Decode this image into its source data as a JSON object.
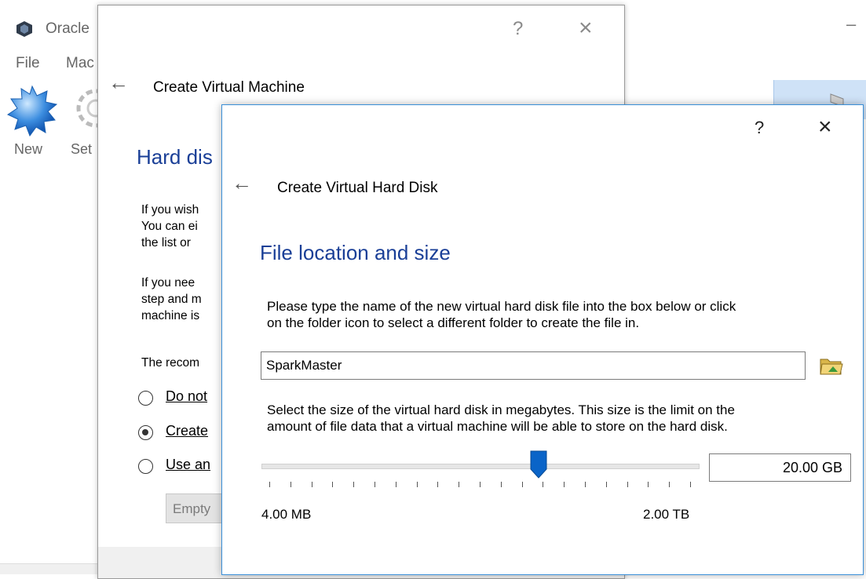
{
  "main_window": {
    "title": "Oracle",
    "menu": [
      "File",
      "Mac"
    ],
    "toolbar": {
      "new_label": "New",
      "settings_label": "Set"
    },
    "minimize": "–"
  },
  "vm_dialog": {
    "help": "?",
    "close": "×",
    "back": "←",
    "title": "Create Virtual Machine",
    "heading": "Hard dis",
    "para1": [
      "If you wish",
      "You can ei",
      "the list or"
    ],
    "para2": [
      "If you nee",
      "step and m",
      "machine is"
    ],
    "para3": "The recom",
    "options": [
      {
        "label": "Do not",
        "checked": false
      },
      {
        "label": "Create",
        "checked": true
      },
      {
        "label": "Use an",
        "checked": false
      }
    ],
    "disk_select": "Empty"
  },
  "hd_dialog": {
    "help": "?",
    "close": "×",
    "back": "←",
    "title": "Create Virtual Hard Disk",
    "heading": "File location and size",
    "location_text_1": "Please type the name of the new virtual hard disk file into the box below or click",
    "location_text_2": "on the folder icon to select a different folder to create the file in.",
    "filename": "SparkMaster",
    "size_text_1": "Select the size of the virtual hard disk in megabytes. This size is the limit on the",
    "size_text_2": "amount of file data that a virtual machine will be able to store on the hard disk.",
    "slider": {
      "min_label": "4.00 MB",
      "max_label": "2.00 TB",
      "position_fraction": 0.635
    },
    "size_value": "20.00 GB"
  }
}
